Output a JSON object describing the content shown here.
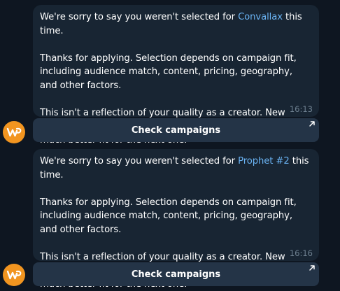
{
  "messages": [
    {
      "intro_before": "We're sorry to say you weren't selected for ",
      "campaign": "Convallax",
      "intro_after": " this time.",
      "paragraph2": "Thanks for applying. Selection depends on campaign fit, including audience match, content, pricing, geography, and other factors.",
      "paragraph3": "This isn't a reflection of your quality as a creator. New campaigns launch regularly, and your profile may be a much better fit for the next one.",
      "time": "16:13",
      "button_label": "Check campaigns"
    },
    {
      "intro_before": "We're sorry to say you weren't selected for ",
      "campaign": "Prophet #2",
      "intro_after": " this time.",
      "paragraph2": "Thanks for applying. Selection depends on campaign fit, including audience match, content, pricing, geography, and other factors.",
      "paragraph3": "This isn't a reflection of your quality as a creator. New campaigns launch regularly, and your profile may be a much better fit for the next one.",
      "time": "16:16",
      "button_label": "Check campaigns"
    }
  ],
  "colors": {
    "background": "#0e1621",
    "bubble": "#182533",
    "button": "#243447",
    "link": "#6ab3f3",
    "avatar": "#f29520"
  },
  "icons": {
    "avatar": "bot-logo-icon",
    "button_arrow": "external-arrow-icon"
  }
}
